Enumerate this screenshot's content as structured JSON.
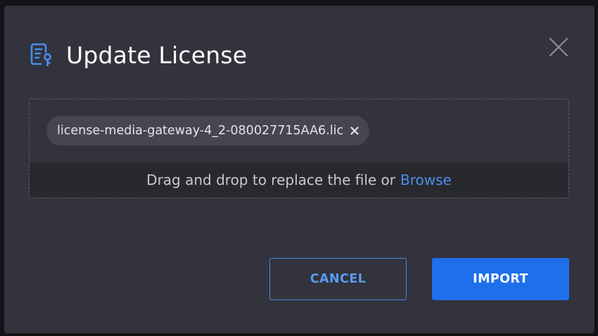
{
  "dialog": {
    "title": "Update License",
    "icon": "license-key-icon",
    "close_icon": "close-icon"
  },
  "dropzone": {
    "file_name": "license-media-gateway-4_2-080027715AA6.lic",
    "remove_icon": "remove-file-icon",
    "hint_text": "Drag and drop to replace the file or",
    "browse_link": "Browse"
  },
  "buttons": {
    "cancel": "CANCEL",
    "import": "IMPORT"
  },
  "colors": {
    "accent": "#1f6fec",
    "link": "#4a90ea",
    "modal_bg": "#32333c"
  }
}
